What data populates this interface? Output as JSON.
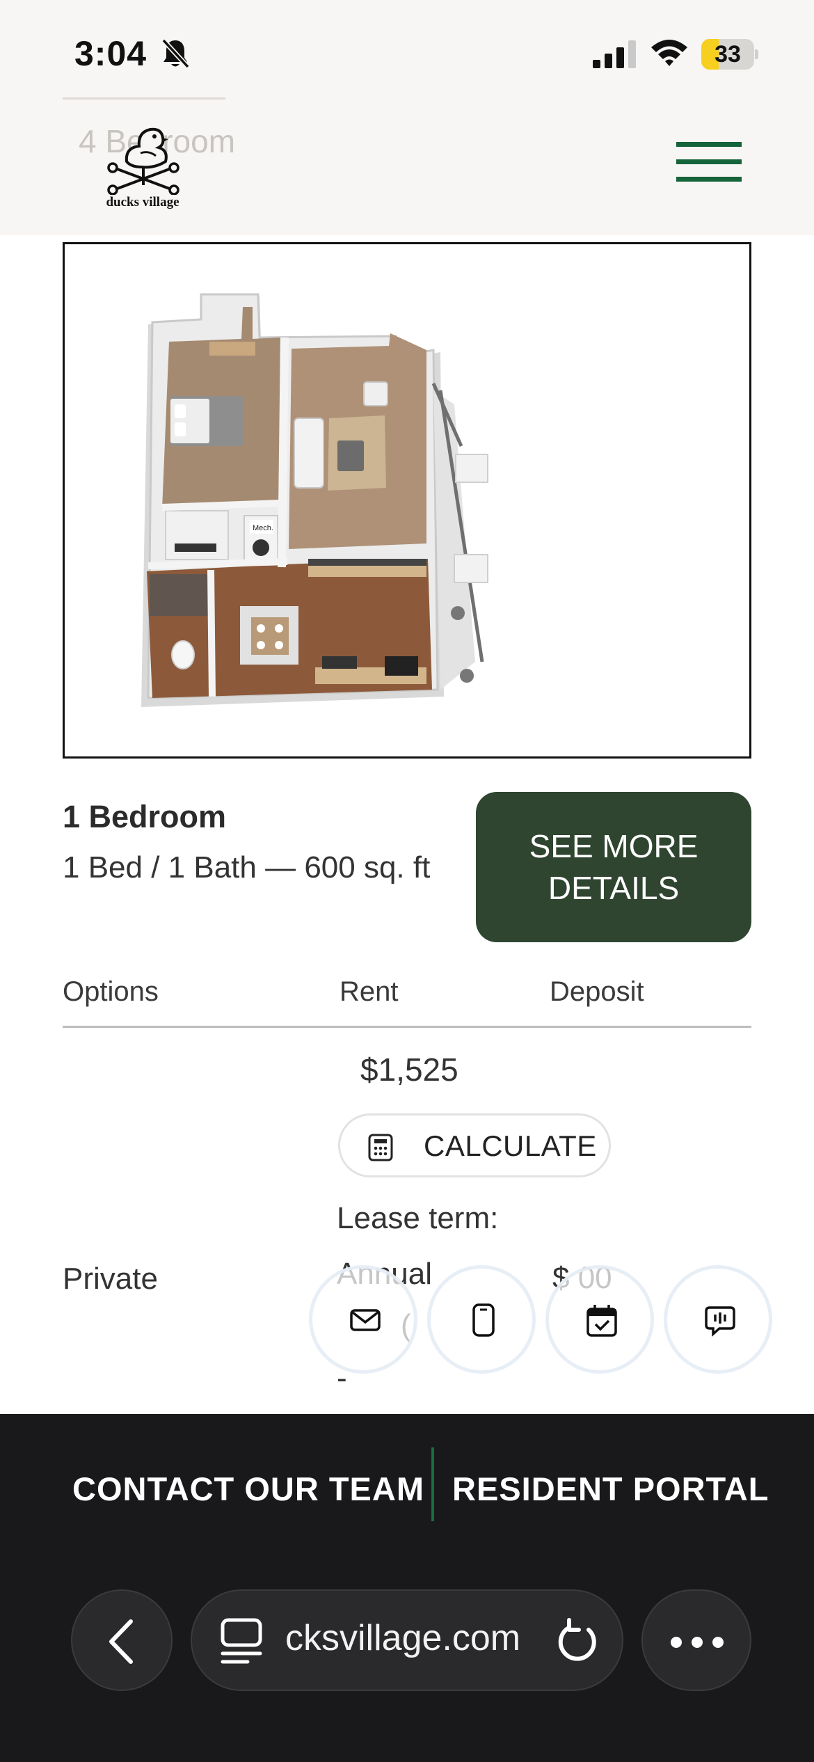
{
  "status_bar": {
    "time": "3:04",
    "battery_level": "33",
    "icons": [
      "bell-slash-icon",
      "cellular-signal-icon",
      "wifi-icon",
      "battery-icon"
    ]
  },
  "header": {
    "ghost_title": "4 Bedroom",
    "logo_text": "ducks village",
    "menu_icon": "hamburger-menu-icon",
    "accent_color": "#16643a"
  },
  "floorplan": {
    "labels": {
      "mech": "Mech."
    }
  },
  "unit": {
    "name": "1 Bedroom",
    "specs": "1 Bed  / 1 Bath — 600 sq. ft",
    "cta_line1": "SEE MORE",
    "cta_line2": "DETAILS",
    "cta_color": "#2f4530"
  },
  "table": {
    "headers": {
      "options": "Options",
      "rent": "Rent",
      "deposit": "Deposit"
    },
    "rent": "$1,525",
    "calculate_label": "CALCULATE",
    "lease_term_label": "Lease term:",
    "option": "Private",
    "lease_value": "Annual",
    "deposit_value": "$     00",
    "lease_value_line2": "(",
    "dash": "-"
  },
  "floating_actions": [
    "mail-icon",
    "phone-icon",
    "calendar-check-icon",
    "chat-icon"
  ],
  "footer": {
    "contact": "CONTACT OUR TEAM",
    "portal": "RESIDENT PORTAL"
  },
  "browser": {
    "url": "cksvillage.com",
    "icons": [
      "back-chevron-icon",
      "tabs-icon",
      "reload-icon",
      "more-dots-icon"
    ]
  }
}
